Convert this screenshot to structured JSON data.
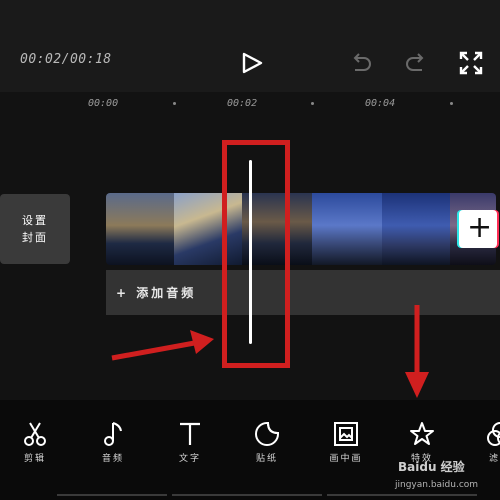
{
  "header": {
    "time": "00:02/00:18"
  },
  "ruler": {
    "labels": [
      "00:00",
      "00:02",
      "00:04"
    ]
  },
  "timeline": {
    "cover_line1": "设置",
    "cover_line2": "封面",
    "add_clip": "+",
    "audio_label": "+ 添加音频"
  },
  "toolbar": {
    "items": [
      {
        "label": "剪辑",
        "icon": "scissors-icon"
      },
      {
        "label": "音频",
        "icon": "music-note-icon"
      },
      {
        "label": "文字",
        "icon": "text-icon"
      },
      {
        "label": "贴纸",
        "icon": "sticker-icon"
      },
      {
        "label": "画中画",
        "icon": "picture-in-picture-icon"
      },
      {
        "label": "特效",
        "icon": "star-effects-icon"
      },
      {
        "label": "滤镜",
        "icon": "filter-icon"
      }
    ]
  },
  "watermark": {
    "brand": "Baidu 经验",
    "url": "jingyan.baidu.com"
  },
  "colors": {
    "annotation_red": "#d01f1f",
    "background": "#121212"
  }
}
